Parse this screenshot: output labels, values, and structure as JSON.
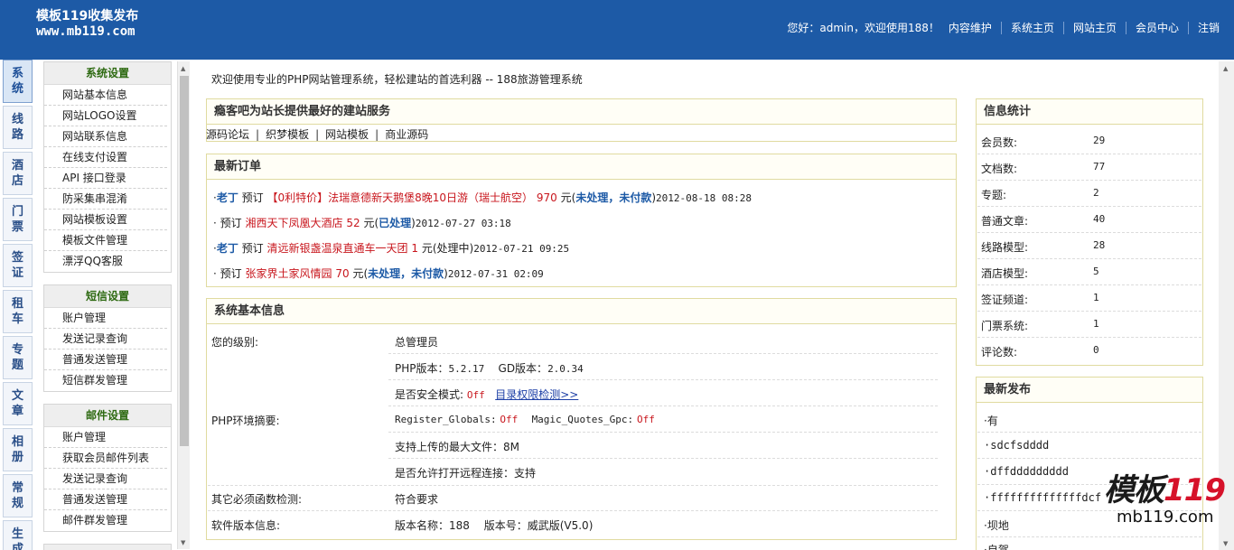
{
  "header": {
    "logo_line1": "模板119收集发布",
    "logo_line2": "www.mb119.com",
    "greeting": "您好：admin，欢迎使用188！",
    "nav": [
      "内容维护",
      "系统主页",
      "网站主页",
      "会员中心",
      "注销"
    ]
  },
  "vtabs": [
    "系统",
    "线路",
    "酒店",
    "门票",
    "签证",
    "租车",
    "专题",
    "文章",
    "相册",
    "常规",
    "生成"
  ],
  "menu": [
    {
      "title": "系统设置",
      "items": [
        "网站基本信息",
        "网站LOGO设置",
        "网站联系信息",
        "在线支付设置",
        "API 接口登录",
        "防采集串混淆",
        "网站模板设置",
        "模板文件管理",
        "漂浮QQ客服"
      ]
    },
    {
      "title": "短信设置",
      "items": [
        "账户管理",
        "发送记录查询",
        "普通发送管理",
        "短信群发管理"
      ]
    },
    {
      "title": "邮件设置",
      "items": [
        "账户管理",
        "获取会员邮件列表",
        "发送记录查询",
        "普通发送管理",
        "邮件群发管理"
      ]
    }
  ],
  "welcome": "欢迎使用专业的PHP网站管理系统，轻松建站的首选利器 -- 188旅游管理系统",
  "service": {
    "title": "瘾客吧为站长提供最好的建站服务",
    "links": [
      "源码论坛",
      "织梦模板",
      "网站模板",
      "商业源码"
    ]
  },
  "orders": {
    "title": "最新订单",
    "rows": [
      {
        "bullet": "·",
        "user": "老丁",
        "verb": "预订",
        "product": "【0利特价】法瑞意德新天鹅堡8晚10日游（瑞士航空）",
        "price": "970",
        "unit": "元(",
        "status": "未处理，未付款",
        "close": ")",
        "time": "2012-08-18 08:28"
      },
      {
        "bullet": "·",
        "user": "",
        "verb": "预订",
        "product": "湘西天下凤凰大酒店",
        "price": "52",
        "unit": "元(",
        "status": "已处理",
        "close": ")",
        "time": "2012-07-27 03:18"
      },
      {
        "bullet": "·",
        "user": "老丁",
        "verb": "预订",
        "product": "清远新银盏温泉直通车一天团",
        "price": "1",
        "unit": "元(",
        "status": "处理中",
        "close": ")",
        "time": "2012-07-21 09:25"
      },
      {
        "bullet": "·",
        "user": "",
        "verb": "预订",
        "product": "张家界土家风情园",
        "price": "70",
        "unit": "元(",
        "status": "未处理，未付款",
        "close": ")",
        "time": "2012-07-31 02:09"
      }
    ]
  },
  "sysinfo": {
    "title": "系统基本信息",
    "level_label": "您的级别:",
    "level_value": "总管理员",
    "php_env_label": "PHP环境摘要:",
    "php_version_label": "PHP版本：",
    "php_version": "5.2.17",
    "gd_label": "GD版本：",
    "gd_version": "2.0.34",
    "safe_mode_label": "是否安全模式:",
    "safe_mode_value": "Off",
    "dir_check_link": "目录权限检测>>",
    "register_globals_label": "Register_Globals:",
    "register_globals_value": "Off",
    "magic_quotes_label": "Magic_Quotes_Gpc:",
    "magic_quotes_value": "Off",
    "max_upload": "支持上传的最大文件：8M",
    "remote_open": "是否允许打开远程连接：支持",
    "func_check_label": "其它必须函数检测:",
    "func_check_value": "符合要求",
    "software_label": "软件版本信息:",
    "software_value": "版本名称：188　 版本号：威武版(V5.0)"
  },
  "stats": {
    "title": "信息统计",
    "rows": [
      {
        "label": "会员数:",
        "value": "29"
      },
      {
        "label": "文档数:",
        "value": "77"
      },
      {
        "label": "专题:",
        "value": "2"
      },
      {
        "label": "普通文章:",
        "value": "40"
      },
      {
        "label": "线路模型:",
        "value": "28"
      },
      {
        "label": "酒店模型:",
        "value": "5"
      },
      {
        "label": "签证频道:",
        "value": "1"
      },
      {
        "label": "门票系统:",
        "value": "1"
      },
      {
        "label": "评论数:",
        "value": "0"
      }
    ]
  },
  "latest": {
    "title": "最新发布",
    "rows": [
      "·有",
      "·sdcfsdddd",
      "·dffddddddddd",
      "·ffffffffffffffdcf",
      "·坝地",
      "·自驾"
    ]
  },
  "watermark": {
    "text_a": "模板",
    "text_b": "119",
    "url": "mb119.com"
  }
}
